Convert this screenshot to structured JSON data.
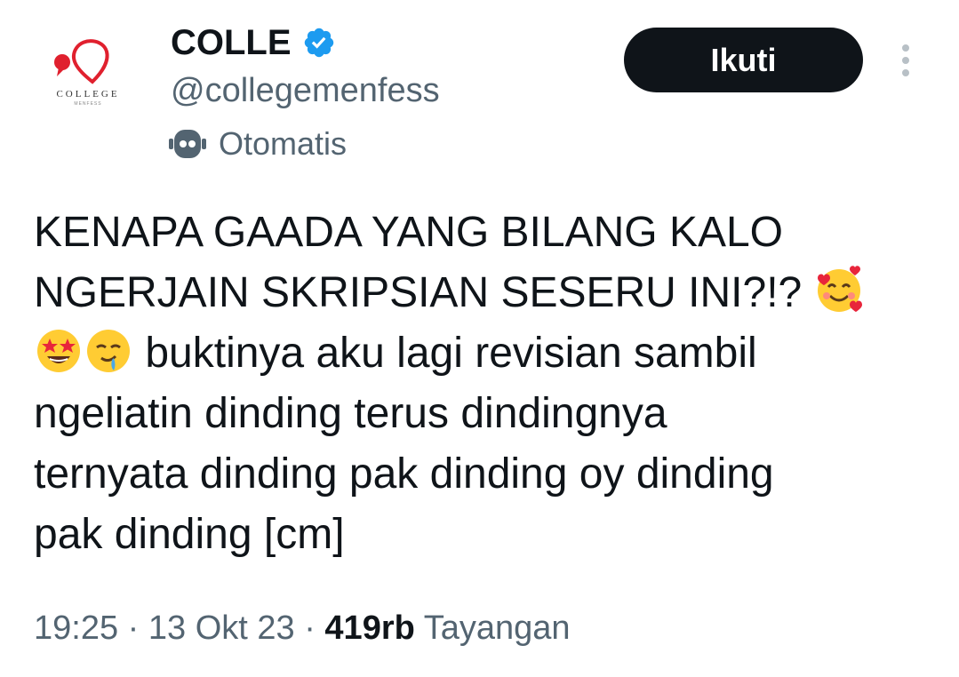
{
  "account": {
    "avatar_logo_text": "COLLEGE",
    "avatar_logo_subtext": "MENFESS",
    "display_name": "COLLE",
    "handle": "@collegemenfess",
    "automated_label": "Otomatis",
    "verified": true
  },
  "actions": {
    "follow_label": "Ikuti"
  },
  "tweet": {
    "line1": "KENAPA GAADA YANG BILANG KALO",
    "line2": "NGERJAIN SKRIPSIAN SESERU INI?!? ",
    "line3": " buktinya aku lagi revisian sambil",
    "line4": "ngeliatin dinding terus dindingnya",
    "line5": "ternyata dinding pak dinding oy dinding",
    "line6": "pak dinding [cm]",
    "emojis": [
      "smiling-face-with-hearts",
      "star-struck",
      "drooling-face"
    ]
  },
  "meta": {
    "time": "19:25",
    "separator": " · ",
    "date": "13 Okt 23",
    "views_count": "419rb",
    "views_label": "Tayangan"
  },
  "colors": {
    "text_primary": "#0f1419",
    "text_secondary": "#536471",
    "verified_blue": "#1d9bf0",
    "logo_red": "#e0202e"
  }
}
